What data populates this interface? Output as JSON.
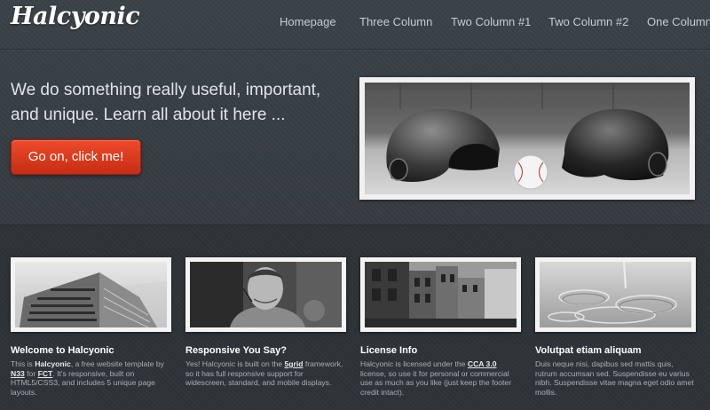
{
  "site": {
    "logo": "Halcyonic"
  },
  "nav": {
    "items": [
      {
        "label": "Homepage"
      },
      {
        "label": "Three Column"
      },
      {
        "label": "Two Column #1"
      },
      {
        "label": "Two Column #2"
      },
      {
        "label": "One Column"
      }
    ]
  },
  "hero": {
    "text": "We do something really useful, important, and unique. Learn all about it here ...",
    "button_label": "Go on, click me!",
    "image_icon": "baseball-helmets-image"
  },
  "features": [
    {
      "title": "Welcome to Halcyonic",
      "image_icon": "building-image",
      "body": [
        {
          "t": "This is "
        },
        {
          "t": "Halcyonic",
          "b": true
        },
        {
          "t": ", a free website template by "
        },
        {
          "t": "N33",
          "u": true
        },
        {
          "t": " for "
        },
        {
          "t": "FCT",
          "u": true
        },
        {
          "t": ". It's responsive, built on HTML5/CSS3, and includes 5 unique page layouts."
        }
      ]
    },
    {
      "title": "Responsive You Say?",
      "image_icon": "person-image",
      "body": [
        {
          "t": "Yes! Halcyonic is built on the "
        },
        {
          "t": "5grid",
          "u": true
        },
        {
          "t": " framework, so it has full responsive support for widescreen, standard, and mobile displays."
        }
      ]
    },
    {
      "title": "License Info",
      "image_icon": "city-street-image",
      "body": [
        {
          "t": "Halcyonic is licensed under the "
        },
        {
          "t": "CCA 3.0",
          "u": true
        },
        {
          "t": " license, so use it for personal or commercial use as much as you like (just keep the footer credit intact)."
        }
      ]
    },
    {
      "title": "Volutpat etiam aliquam",
      "image_icon": "water-image",
      "body": [
        {
          "t": "Duis neque nisi, dapibus sed mattis quis, rutrum accumsan sed. Suspendisse eu varius nibh. Suspendisse vitae magna eget odio amet mollis."
        }
      ]
    }
  ]
}
